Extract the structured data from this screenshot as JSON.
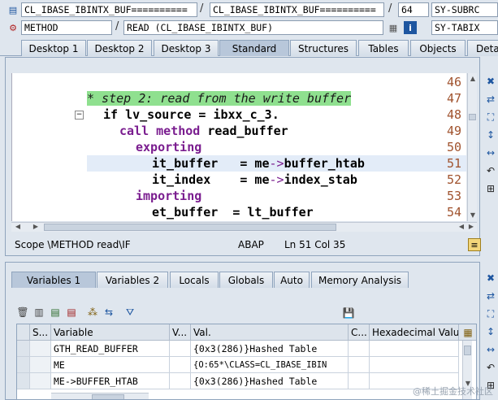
{
  "header": {
    "row1": {
      "field1": "CL_IBASE_IBINTX_BUF==========",
      "field2": "CL_IBASE_IBINTX_BUF==========",
      "line": "64",
      "var_name": "SY-SUBRC"
    },
    "row2": {
      "event_type": "METHOD",
      "event_name": "READ (CL_IBASE_IBINTX_BUF)",
      "var_name": "SY-TABIX"
    }
  },
  "tabs": [
    "Desktop 1",
    "Desktop 2",
    "Desktop 3",
    "Standard",
    "Structures",
    "Tables",
    "Objects",
    "Deta"
  ],
  "active_tab": "Standard",
  "editor": {
    "lines": [
      {
        "num": "46"
      },
      {
        "num": "47",
        "comment": "* step 2: read from the write buffer"
      },
      {
        "num": "48",
        "kw1": "if",
        "t1": " lv_source = ibxx_c_3."
      },
      {
        "num": "49",
        "kw1": "call method",
        "t1": " read_buffer"
      },
      {
        "num": "50",
        "kw1": "exporting"
      },
      {
        "num": "51",
        "t1": "it_buffer   = me",
        "arrow": "->",
        "t2": "buffer_htab"
      },
      {
        "num": "52",
        "t1": "it_index    = me",
        "arrow": "->",
        "t2": "index_stab"
      },
      {
        "num": "53",
        "kw1": "importing"
      },
      {
        "num": "54",
        "t1": "et_buffer  = lt_buffer"
      }
    ]
  },
  "status": {
    "scope": "Scope \\METHOD read\\IF",
    "lang": "ABAP",
    "position": "Ln  51 Col  35"
  },
  "bottom_tabs": [
    "Variables 1",
    "Variables 2",
    "Locals",
    "Globals",
    "Auto",
    "Memory Analysis"
  ],
  "active_bottom_tab": "Variables 1",
  "grid": {
    "columns": [
      "S...",
      "Variable",
      "V...",
      "Val.",
      "C...",
      "Hexadecimal Value"
    ],
    "rows": [
      {
        "variable": "GTH_READ_BUFFER",
        "value": "{0x3(286)}Hashed Table"
      },
      {
        "variable": "ME",
        "value": "{O:65*\\CLASS=CL_IBASE_IBIN"
      },
      {
        "variable": "ME->BUFFER_HTAB",
        "value": "{0x3(286)}Hashed Table"
      }
    ]
  },
  "watermark": "@稀土掘金技术社区"
}
